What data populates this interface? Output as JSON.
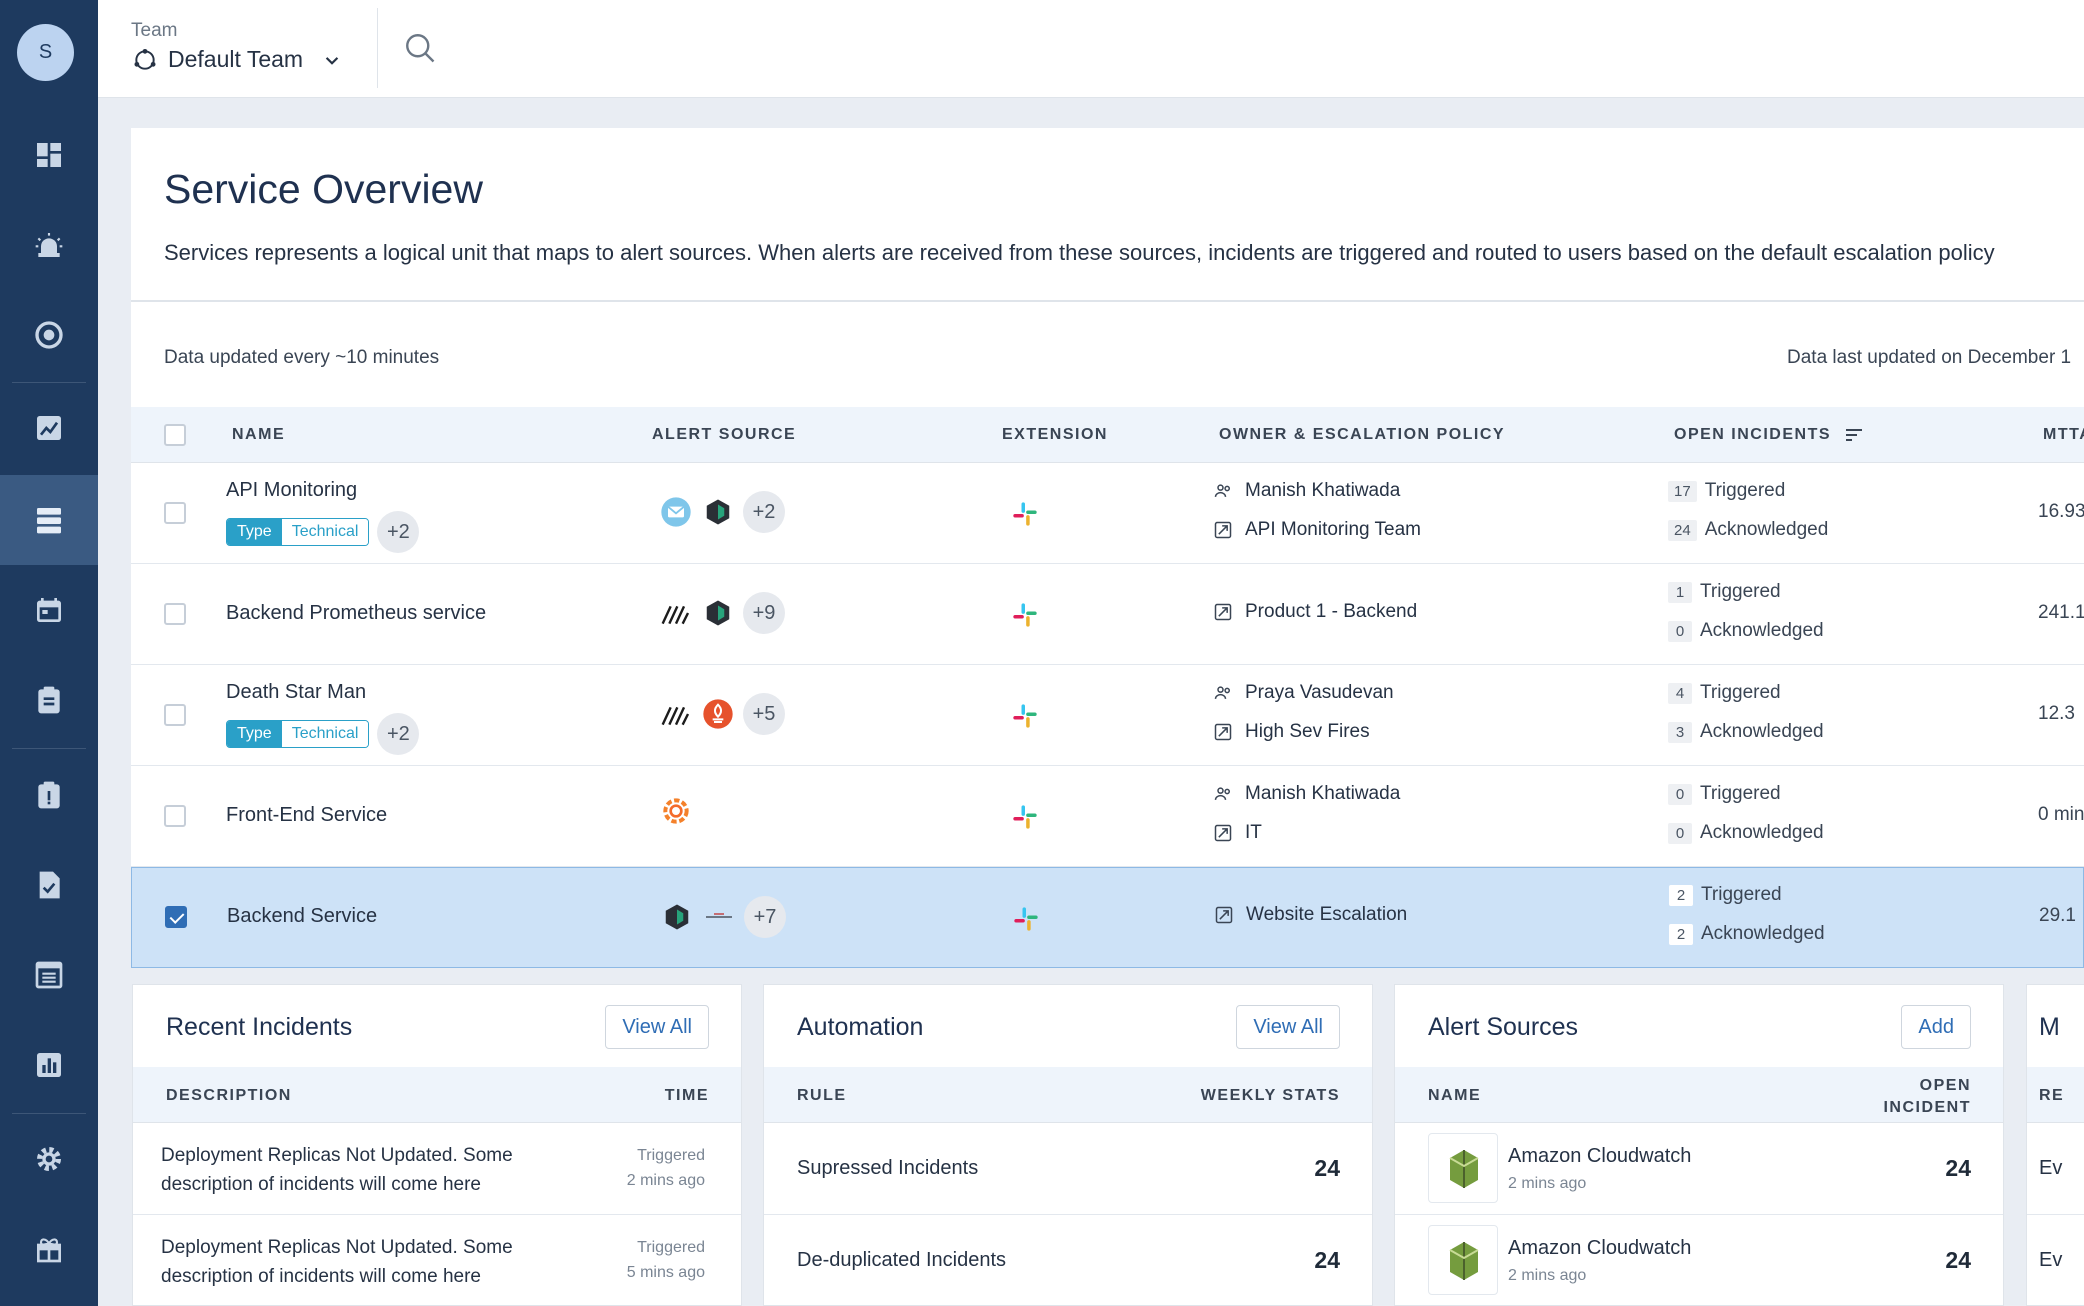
{
  "user": {
    "initial": "S"
  },
  "header": {
    "team_label": "Team",
    "team_name": "Default Team"
  },
  "page": {
    "title": "Service Overview",
    "description": "Services represents a logical unit that maps to alert sources. When alerts are received from these sources, incidents are triggered and routed to users based on the default escalation policy",
    "update_interval": "Data updated every ~10 minutes",
    "last_updated": "Data last updated on December 1"
  },
  "table": {
    "headers": {
      "name": "NAME",
      "alert_source": "ALERT SOURCE",
      "extension": "EXTENSION",
      "owner": "OWNER & ESCALATION POLICY",
      "open_incidents": "OPEN INCIDENTS",
      "mtta": "MTTA"
    },
    "rows": [
      {
        "name": "API Monitoring",
        "tag_key": "Type",
        "tag_value": "Technical",
        "tag_more": "+2",
        "sources_more": "+2",
        "owner": "Manish Khatiwada",
        "policy": "API Monitoring Team",
        "triggered": "17",
        "acknowledged": "24",
        "triggered_label": "Triggered",
        "acknowledged_label": "Acknowledged",
        "mtta": "16.93"
      },
      {
        "name": "Backend Prometheus service",
        "sources_more": "+9",
        "policy": "Product 1 - Backend",
        "triggered": "1",
        "acknowledged": "0",
        "triggered_label": "Triggered",
        "acknowledged_label": "Acknowledged",
        "mtta": "241.1"
      },
      {
        "name": "Death Star Man",
        "tag_key": "Type",
        "tag_value": "Technical",
        "tag_more": "+2",
        "sources_more": "+5",
        "owner": "Praya Vasudevan",
        "policy": "High Sev Fires",
        "triggered": "4",
        "acknowledged": "3",
        "triggered_label": "Triggered",
        "acknowledged_label": "Acknowledged",
        "mtta": "12.3"
      },
      {
        "name": "Front-End Service",
        "owner": "Manish Khatiwada",
        "policy": "IT",
        "triggered": "0",
        "acknowledged": "0",
        "triggered_label": "Triggered",
        "acknowledged_label": "Acknowledged",
        "mtta": "0 min"
      },
      {
        "name": "Backend Service",
        "sources_more": "+7",
        "policy": "Website Escalation",
        "triggered": "2",
        "acknowledged": "2",
        "triggered_label": "Triggered",
        "acknowledged_label": "Acknowledged",
        "mtta": "29.1"
      }
    ]
  },
  "recent_incidents": {
    "title": "Recent Incidents",
    "button": "View All",
    "col_description": "DESCRIPTION",
    "col_time": "TIME",
    "items": [
      {
        "description": "Deployment Replicas Not Updated. Some description of incidents will come here",
        "status": "Triggered",
        "time": "2 mins ago"
      },
      {
        "description": "Deployment Replicas Not Updated. Some description of incidents will come here",
        "status": "Triggered",
        "time": "5 mins ago"
      }
    ]
  },
  "automation": {
    "title": "Automation",
    "button": "View All",
    "col_rule": "RULE",
    "col_stats": "WEEKLY STATS",
    "items": [
      {
        "rule": "Supressed Incidents",
        "value": "24"
      },
      {
        "rule": "De-duplicated Incidents",
        "value": "24"
      }
    ]
  },
  "alert_sources": {
    "title": "Alert Sources",
    "button": "Add",
    "col_name": "NAME",
    "col_open_1": "OPEN",
    "col_open_2": "INCIDENT",
    "items": [
      {
        "name": "Amazon Cloudwatch",
        "time": "2 mins ago",
        "value": "24"
      },
      {
        "name": "Amazon Cloudwatch",
        "time": "2 mins ago",
        "value": "24"
      }
    ]
  },
  "fourth_panel": {
    "title_partial": "M",
    "col_partial": "RE",
    "row1": "Ev",
    "row2": "Ev"
  },
  "colors": {
    "sidebar": "#1e3a5f",
    "sidebar_active": "#3a5a82",
    "accent": "#2f6db5",
    "tag": "#2aa0c8",
    "selected_row": "#cde2f7"
  }
}
